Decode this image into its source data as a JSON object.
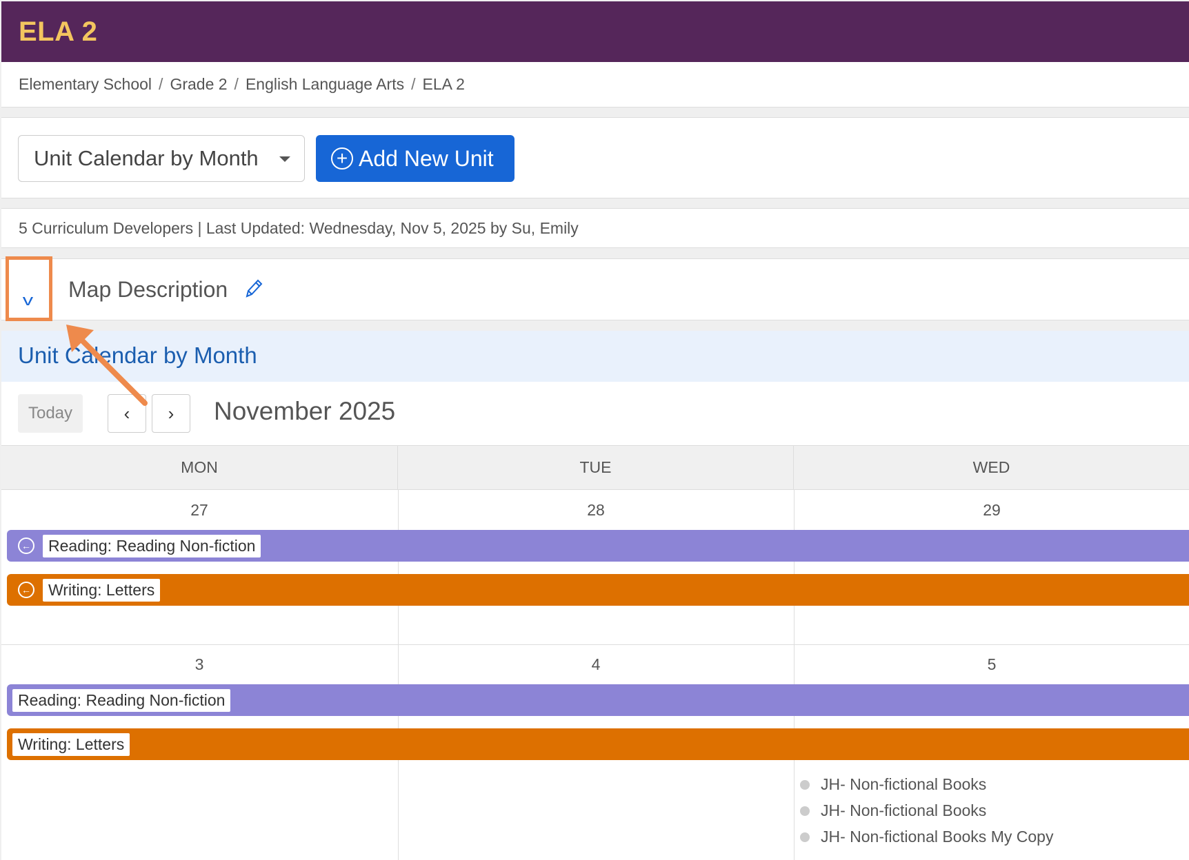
{
  "header": {
    "title": "ELA 2"
  },
  "breadcrumb": [
    "Elementary School",
    "Grade 2",
    "English Language Arts",
    "ELA 2"
  ],
  "toolbar": {
    "view_select": "Unit Calendar by Month",
    "add_unit": "Add New Unit"
  },
  "meta": {
    "text": "5 Curriculum Developers | Last Updated: Wednesday, Nov 5, 2025 by Su, Emily"
  },
  "map_description": {
    "label": "Map Description"
  },
  "calendar": {
    "section_title": "Unit Calendar by Month",
    "today": "Today",
    "month": "November 2025",
    "weekdays": [
      "MON",
      "TUE",
      "WED"
    ],
    "week1": {
      "days": [
        "27",
        "28",
        "29"
      ]
    },
    "week2": {
      "days": [
        "3",
        "4",
        "5"
      ]
    },
    "units": {
      "reading": "Reading: Reading Non-fiction",
      "writing": "Writing: Letters"
    },
    "lessons": [
      "JH- Non-fictional Books",
      "JH- Non-fictional Books",
      "JH- Non-fictional Books My Copy"
    ]
  },
  "colors": {
    "header": "#55265a",
    "title": "#f3c55f",
    "primary": "#1766d6",
    "reading": "#8c84d6",
    "writing": "#dd7000",
    "highlight": "#ee8a4c"
  }
}
